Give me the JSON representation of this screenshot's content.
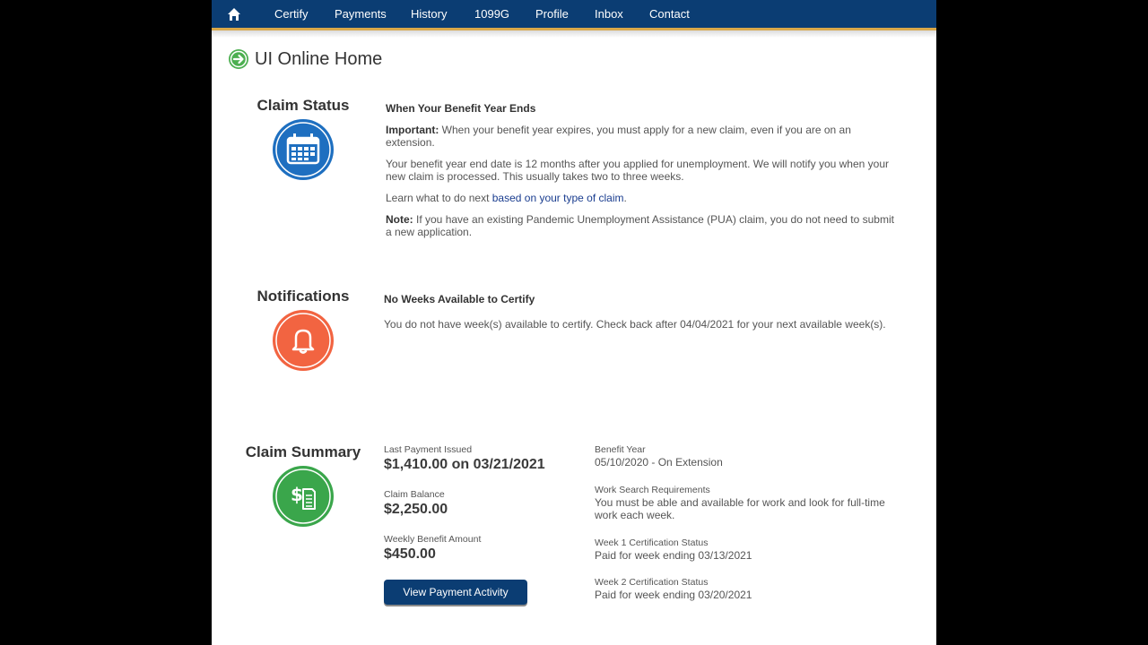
{
  "nav": {
    "items": [
      "Certify",
      "Payments",
      "History",
      "1099G",
      "Profile",
      "Inbox",
      "Contact"
    ],
    "home_icon": "home-icon"
  },
  "page": {
    "title": "UI Online Home"
  },
  "claim_status": {
    "title": "Claim Status",
    "icon": "calendar-icon",
    "heading": "When Your Benefit Year Ends",
    "p1_label": "Important:",
    "p1_text": " When your benefit year expires, you must apply for a new claim, even if you are on an extension.",
    "p2": "Your benefit year end date is 12 months after you applied for unemployment. We will notify you when your new claim is processed. This usually takes two to three weeks.",
    "p3_prefix": "Learn what to do next ",
    "p3_link": "based on your type of claim",
    "p3_suffix": ".",
    "p4_label": "Note:",
    "p4_text": " If you have an existing Pandemic Unemployment Assistance (PUA) claim, you do not need to submit a new application."
  },
  "notifications": {
    "title": "Notifications",
    "icon": "bell-icon",
    "heading": "No Weeks Available to Certify",
    "text": "You do not have week(s) available to certify. Check back after 04/04/2021 for your next available week(s)."
  },
  "claim_summary": {
    "title": "Claim Summary",
    "icon": "dollar-document-icon",
    "last_payment_label": "Last Payment Issued",
    "last_payment_value": "$1,410.00 on 03/21/2021",
    "balance_label": "Claim Balance",
    "balance_value": "$2,250.00",
    "weekly_label": "Weekly Benefit Amount",
    "weekly_value": "$450.00",
    "button_label": "View Payment Activity",
    "benefit_year_label": "Benefit Year",
    "benefit_year_value": "05/10/2020 - On Extension",
    "work_search_label": "Work Search Requirements",
    "work_search_value": "You must be able and available for work and look for full-time work each week.",
    "week1_label": "Week 1 Certification Status",
    "week1_value": "Paid for week ending 03/13/2021",
    "week2_label": "Week 2 Certification Status",
    "week2_value": "Paid for week ending 03/20/2021"
  },
  "colors": {
    "nav_bg": "#0b3d73",
    "nav_accent": "#d9a84a",
    "status_blue": "#1e6fc0",
    "notify_orange": "#f26441",
    "summary_green": "#3aa64b"
  }
}
